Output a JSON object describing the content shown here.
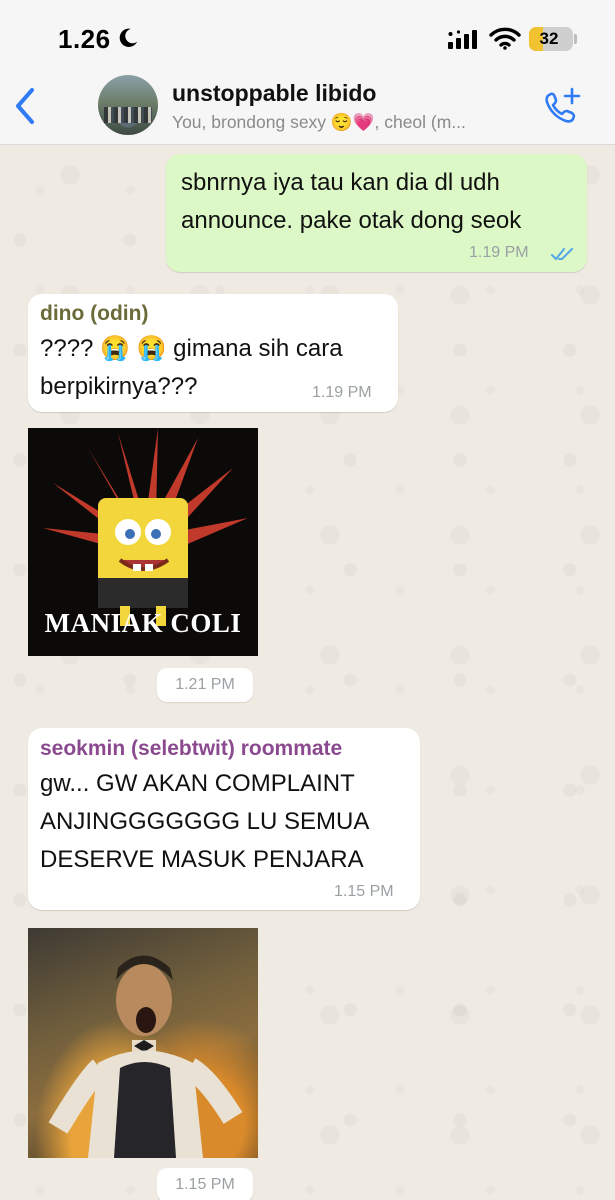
{
  "status_bar": {
    "time": "1.26",
    "battery": "32",
    "battery_level": 0.32
  },
  "header": {
    "title": "unstoppable libido",
    "subtitle": "You, brondong sexy 😌💗, cheol (m..."
  },
  "messages": [
    {
      "type": "outgoing",
      "lines": [
        "sbnrnya iya tau kan dia dl udh",
        "announce. pake otak dong seok"
      ],
      "time": "1.19 PM",
      "status": "read"
    },
    {
      "type": "incoming",
      "sender": "dino (odin)",
      "sender_color": "#6b6b3a",
      "lines": [
        "???? 😭 😭 gimana sih cara",
        "berpikirnya???"
      ],
      "time": "1.19 PM"
    },
    {
      "type": "sticker",
      "caption": "MANIAK COLI",
      "time": "1.21 PM"
    },
    {
      "type": "incoming",
      "sender": "seokmin (selebtwit) roommate",
      "sender_color": "#8b4a8f",
      "lines": [
        "gw... GW AKAN COMPLAINT",
        "ANJINGGGGGGG LU SEMUA",
        "DESERVE MASUK PENJARA"
      ],
      "time": "1.15 PM"
    },
    {
      "type": "sticker",
      "time": "1.15 PM"
    }
  ],
  "colors": {
    "outgoing_bubble": "#dcf8c6",
    "incoming_bubble": "#ffffff",
    "accent": "#2f7bf6",
    "read_ticks": "#53a6e7"
  },
  "icons": {
    "back": "chevron-left-icon",
    "call": "add-call-icon",
    "moon": "moon-icon",
    "signal": "signal-icon",
    "wifi": "wifi-icon"
  }
}
